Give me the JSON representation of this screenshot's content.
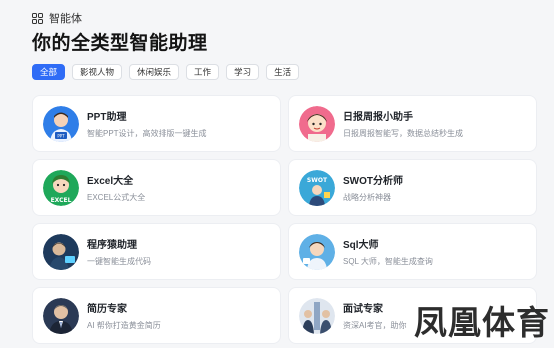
{
  "breadcrumb": {
    "label": "智能体",
    "icon": "apps-grid-icon"
  },
  "page_title": "你的全类型智能助理",
  "tabs": [
    {
      "label": "全部",
      "active": true
    },
    {
      "label": "影视人物",
      "active": false
    },
    {
      "label": "休闲娱乐",
      "active": false
    },
    {
      "label": "工作",
      "active": false
    },
    {
      "label": "学习",
      "active": false
    },
    {
      "label": "生活",
      "active": false
    }
  ],
  "cards": [
    {
      "name": "PPT助理",
      "desc": "智能PPT设计，高效排版一键生成",
      "avatar": "ppt-assistant-avatar",
      "avatar_bg": "#2f7ee8",
      "avatar_text": "PPT"
    },
    {
      "name": "日报周报小助手",
      "desc": "日报周报智能写，数据总结秒生成",
      "avatar": "report-helper-avatar",
      "avatar_bg": "#f06b8d",
      "avatar_text": ""
    },
    {
      "name": "Excel大全",
      "desc": "EXCEL公式大全",
      "avatar": "excel-avatar",
      "avatar_bg": "#1fa85a",
      "avatar_text": "EXCEL"
    },
    {
      "name": "SWOT分析师",
      "desc": "战略分析神器",
      "avatar": "swot-analyst-avatar",
      "avatar_bg": "#3aa8d8",
      "avatar_text": "SWOT"
    },
    {
      "name": "程序猿助理",
      "desc": "一键智能生成代码",
      "avatar": "programmer-avatar",
      "avatar_bg": "#1e3a5c",
      "avatar_text": ""
    },
    {
      "name": "Sql大师",
      "desc": "SQL 大师，智能生成查询",
      "avatar": "sql-master-avatar",
      "avatar_bg": "#5fb0e6",
      "avatar_text": ""
    },
    {
      "name": "简历专家",
      "desc": "AI 帮你打造黄金简历",
      "avatar": "resume-expert-avatar",
      "avatar_bg": "#2b3a55",
      "avatar_text": ""
    },
    {
      "name": "面试专家",
      "desc": "资深AI考官，助你",
      "avatar": "interview-expert-avatar",
      "avatar_bg": "#8fa6c4",
      "avatar_text": ""
    }
  ],
  "watermark": "凤凰体育"
}
